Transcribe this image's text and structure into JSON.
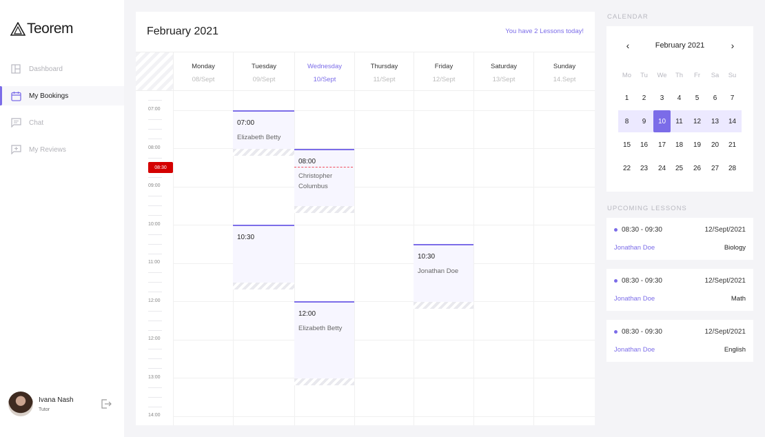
{
  "brand": {
    "name": "Teorem"
  },
  "sidebar": {
    "items": [
      {
        "label": "Dashboard",
        "icon": "dashboard-icon",
        "active": false
      },
      {
        "label": "My Bookings",
        "icon": "calendar-icon",
        "active": true
      },
      {
        "label": "Chat",
        "icon": "chat-icon",
        "active": false
      },
      {
        "label": "My Reviews",
        "icon": "reviews-icon",
        "active": false
      }
    ],
    "user": {
      "name": "Ivana Nash",
      "role": "Tutor"
    }
  },
  "calendar": {
    "title": "February 2021",
    "lessons_today": "You have 2 Lessons today!",
    "days": [
      {
        "name": "Monday",
        "date": "08/Sept"
      },
      {
        "name": "Tuesday",
        "date": "09/Sept"
      },
      {
        "name": "Wednesday",
        "date": "10/Sept",
        "today": true
      },
      {
        "name": "Thursday",
        "date": "11/Sept"
      },
      {
        "name": "Friday",
        "date": "12/Sept"
      },
      {
        "name": "Saturday",
        "date": "13/Sept"
      },
      {
        "name": "Sunday",
        "date": "14.Sept"
      }
    ],
    "times": [
      "07:00",
      "08:00",
      "09:00",
      "10:00",
      "11:00",
      "12:00",
      "12:00",
      "13:00",
      "14:00"
    ],
    "now": "08:30",
    "events": [
      {
        "day": 1,
        "time": "07:00",
        "name": "Elizabeth Betty"
      },
      {
        "day": 2,
        "time": "08:00",
        "name": "Christopher Columbus"
      },
      {
        "day": 1,
        "time": "10:30",
        "name": ""
      },
      {
        "day": 4,
        "time": "10:30",
        "name": "Jonathan Doe"
      },
      {
        "day": 2,
        "time": "12:00",
        "name": "Elizabeth Betty"
      }
    ]
  },
  "right_panel": {
    "calendar_title": "CALENDAR",
    "mini_calendar": {
      "month": "February 2021",
      "dow": [
        "Mo",
        "Tu",
        "We",
        "Th",
        "Fr",
        "Sa",
        "Su"
      ],
      "weeks": [
        [
          "1",
          "2",
          "3",
          "4",
          "5",
          "6",
          "7"
        ],
        [
          "8",
          "9",
          "10",
          "11",
          "12",
          "13",
          "14"
        ],
        [
          "15",
          "16",
          "17",
          "18",
          "19",
          "20",
          "21"
        ],
        [
          "22",
          "23",
          "24",
          "25",
          "26",
          "27",
          "28"
        ]
      ],
      "selected": "10"
    },
    "upcoming_title": "UPCOMING LESSONS",
    "lessons": [
      {
        "time": "08:30 - 09:30",
        "date": "12/Sept/2021",
        "name": "Jonathan Doe",
        "subject": "Biology"
      },
      {
        "time": "08:30 - 09:30",
        "date": "12/Sept/2021",
        "name": "Jonathan Doe",
        "subject": "Math"
      },
      {
        "time": "08:30 - 09:30",
        "date": "12/Sept/2021",
        "name": "Jonathan Doe",
        "subject": "English"
      }
    ]
  },
  "colors": {
    "accent": "#7b6ce8",
    "now": "#d40000",
    "event_bg": "#f7f6ff"
  }
}
